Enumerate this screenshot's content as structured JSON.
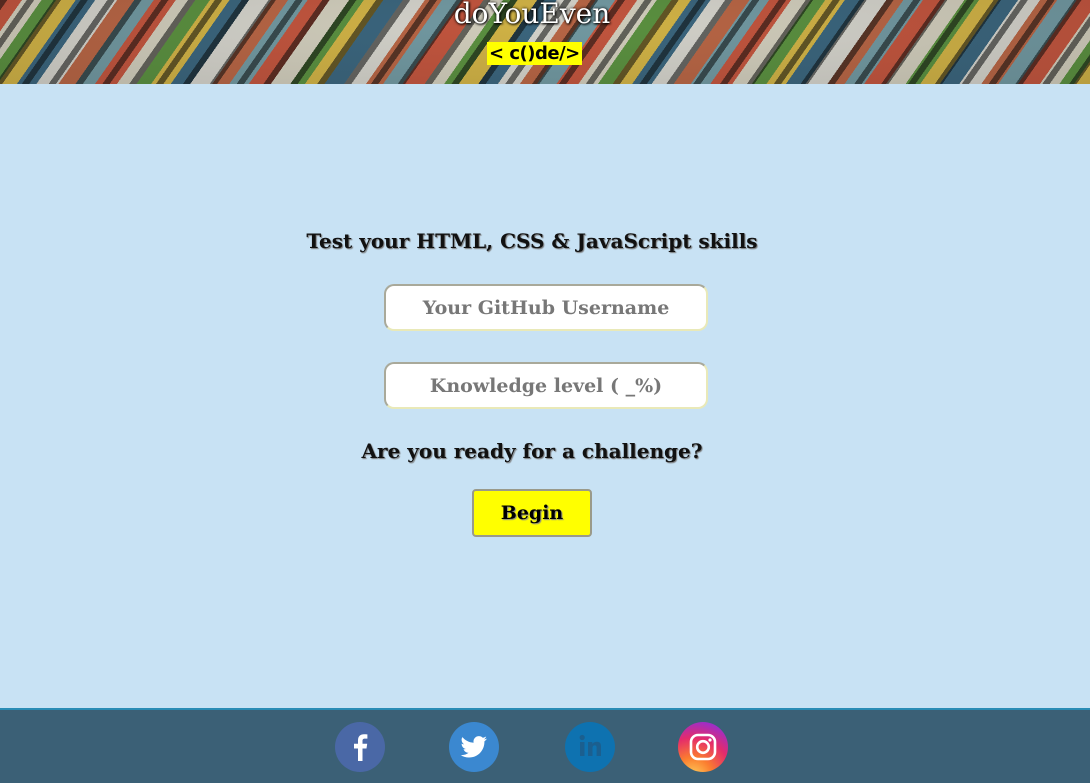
{
  "header": {
    "title": "doYouEven",
    "tagline": "< c()de/>"
  },
  "main": {
    "intro": "Test your HTML, CSS & JavaScript skills",
    "username_placeholder": "Your GitHub Username",
    "knowledge_placeholder": "Knowledge level ( _%)",
    "challenge": "Are you ready for a challenge?",
    "begin_label": "Begin"
  },
  "footer": {
    "social": [
      {
        "name": "facebook",
        "icon": "facebook-icon",
        "color": "#4a68a6"
      },
      {
        "name": "twitter",
        "icon": "twitter-icon",
        "color": "#3b88d0"
      },
      {
        "name": "linkedin",
        "icon": "linkedin-icon",
        "color": "#0e72b0"
      },
      {
        "name": "instagram",
        "icon": "instagram-icon",
        "color": "#e42b6b"
      }
    ]
  },
  "colors": {
    "page_background": "#c8e2f4",
    "accent_yellow": "#ffff00",
    "footer_background": "#3b6076"
  }
}
